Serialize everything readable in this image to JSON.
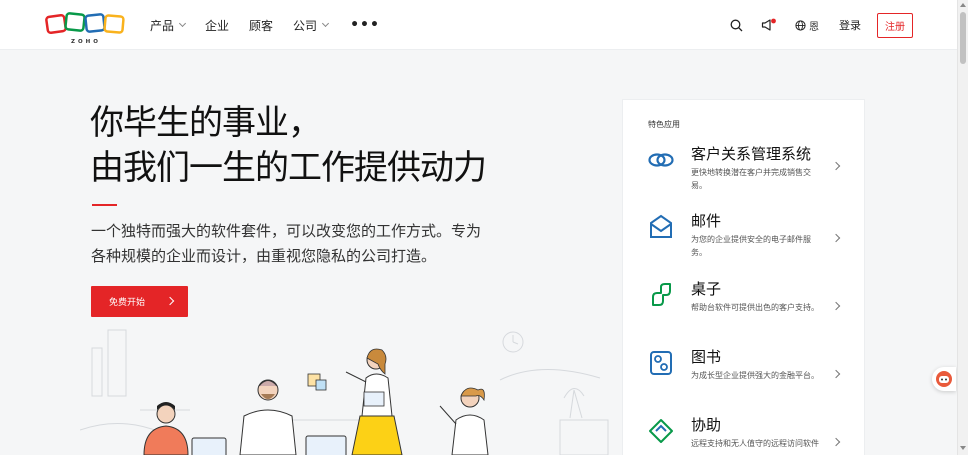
{
  "logo": {
    "text": "ZOHO"
  },
  "nav": {
    "items": [
      {
        "label": "产品",
        "dropdown": true
      },
      {
        "label": "企业",
        "dropdown": false
      },
      {
        "label": "顾客",
        "dropdown": false
      },
      {
        "label": "公司",
        "dropdown": true
      }
    ],
    "more_label": "•••"
  },
  "header_right": {
    "language": "恩",
    "login_label": "登录",
    "signup_label": "注册"
  },
  "hero": {
    "title_line1": "你毕生的事业，",
    "title_line2": "由我们一生的工作提供动力",
    "subtitle": "一个独特而强大的软件套件，可以改变您的工作方式。专为各种规模的企业而设计，由重视您隐私的公司打造。",
    "cta_label": "免费开始"
  },
  "apps_panel": {
    "label": "特色应用",
    "apps": [
      {
        "name": "客户关系管理系统",
        "desc": "更快地转换潜在客户并完成销售交易。",
        "icon": "crm-icon"
      },
      {
        "name": "邮件",
        "desc": "为您的企业提供安全的电子邮件服务。",
        "icon": "mail-icon"
      },
      {
        "name": "桌子",
        "desc": "帮助台软件可提供出色的客户支持。",
        "icon": "desk-icon"
      },
      {
        "name": "图书",
        "desc": "为成长型企业提供强大的金融平台。",
        "icon": "books-icon"
      },
      {
        "name": "协助",
        "desc": "远程支持和无人值守的远程访问软件",
        "icon": "assist-icon"
      }
    ]
  },
  "colors": {
    "accent": "#e42527",
    "logo_red": "#e42527",
    "logo_green": "#089949",
    "logo_blue": "#226db4",
    "logo_yellow": "#f9b21d",
    "app_icon_blue": "#226db4",
    "app_icon_green": "#089949"
  }
}
